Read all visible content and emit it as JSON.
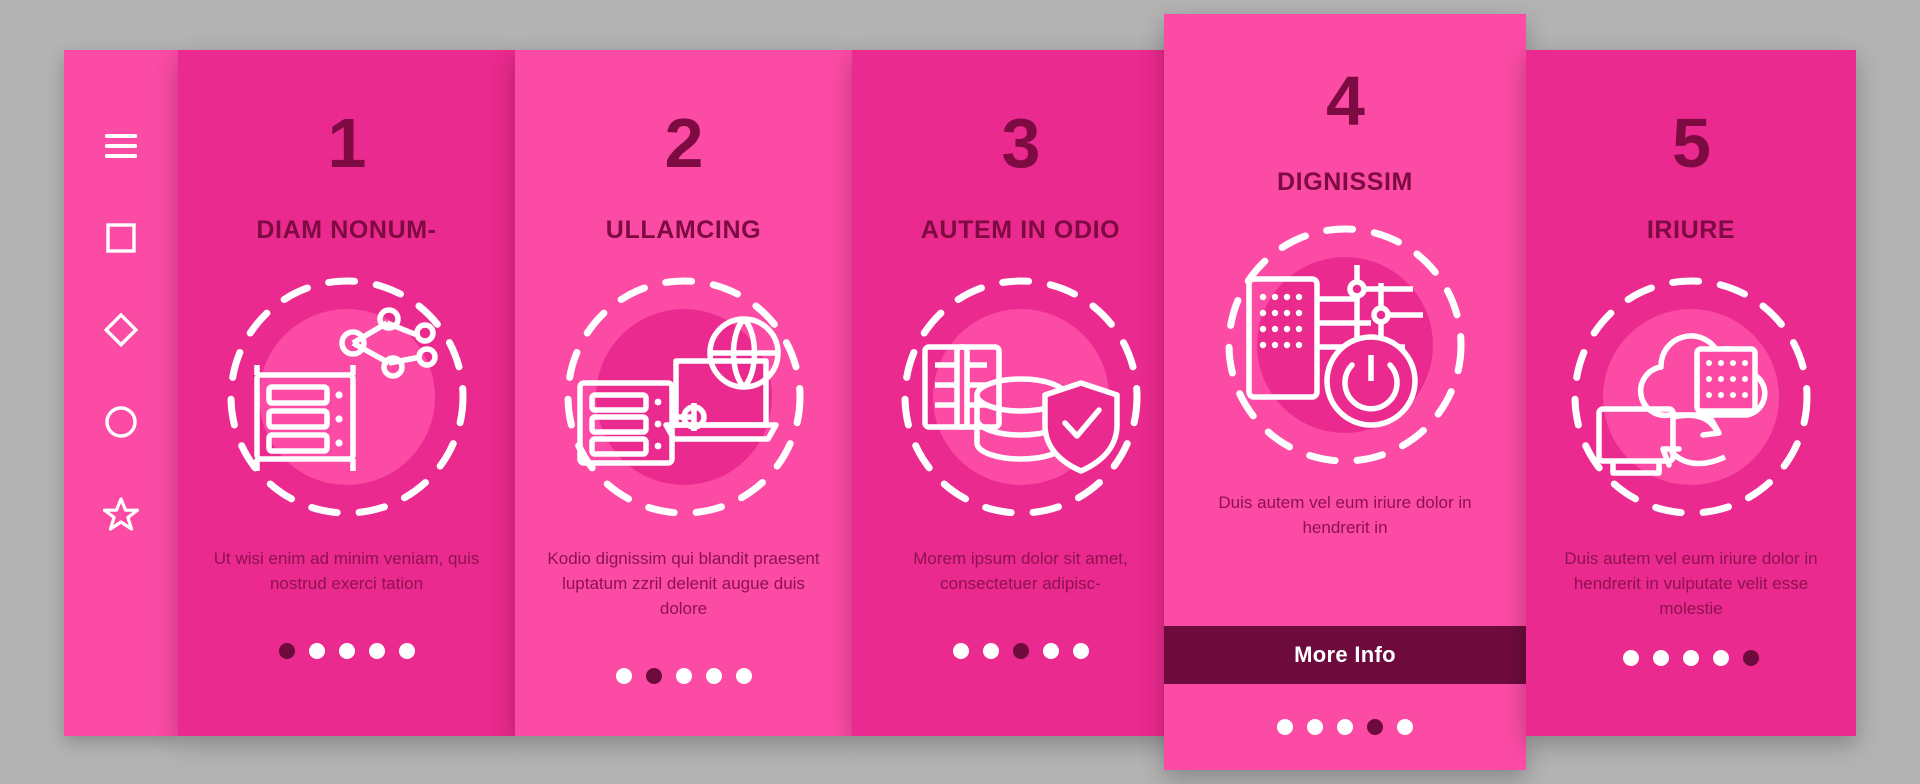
{
  "canvas": {
    "background": "#b3b3b3",
    "color_card_dark": "#ea2a8e",
    "color_card_light": "#fb4ba5",
    "color_heading": "#7d0b42",
    "color_body": "#8e1152",
    "color_accent_dark": "#6d0b3c",
    "color_icon": "#ffffff"
  },
  "sidebar": {
    "items": [
      {
        "name": "hamburger-menu-icon",
        "label": "menu"
      },
      {
        "name": "square-icon",
        "label": "square"
      },
      {
        "name": "diamond-icon",
        "label": "diamond"
      },
      {
        "name": "circle-icon",
        "label": "circle"
      },
      {
        "name": "star-icon",
        "label": "star"
      }
    ]
  },
  "cards": [
    {
      "number": "1",
      "title": "DIAM NONUM-",
      "body": "Ut wisi enim ad minim veniam, quis nostrud exerci tation",
      "icon": "server-network-icon",
      "theme": "dark",
      "dots": {
        "count": 5,
        "active": 1
      },
      "has_more_info": false
    },
    {
      "number": "2",
      "title": "ULLAMCING",
      "body": "Kodio dignissim qui blandit praesent luptatum zzril delenit augue duis dolore",
      "icon": "server-globe-laptop-icon",
      "theme": "light",
      "dots": {
        "count": 5,
        "active": 2
      },
      "has_more_info": false
    },
    {
      "number": "3",
      "title": "AUTEM IN ODIO",
      "body": "Morem ipsum dolor sit amet, consectetuer adipisc-",
      "icon": "database-shield-icon",
      "theme": "dark",
      "dots": {
        "count": 5,
        "active": 3
      },
      "has_more_info": false
    },
    {
      "number": "4",
      "title": "DIGNISSIM",
      "body": "Duis autem vel eum iriure dolor in hendrerit in",
      "icon": "server-power-icon",
      "theme": "light",
      "dots": {
        "count": 5,
        "active": 4
      },
      "has_more_info": true,
      "more_info_label": "More Info"
    },
    {
      "number": "5",
      "title": "IRIURE",
      "body": "Duis autem vel eum iriure dolor in hendrerit in vulputate velit esse molestie",
      "icon": "cloud-server-sync-icon",
      "theme": "dark",
      "dots": {
        "count": 5,
        "active": 5
      },
      "has_more_info": false
    }
  ]
}
